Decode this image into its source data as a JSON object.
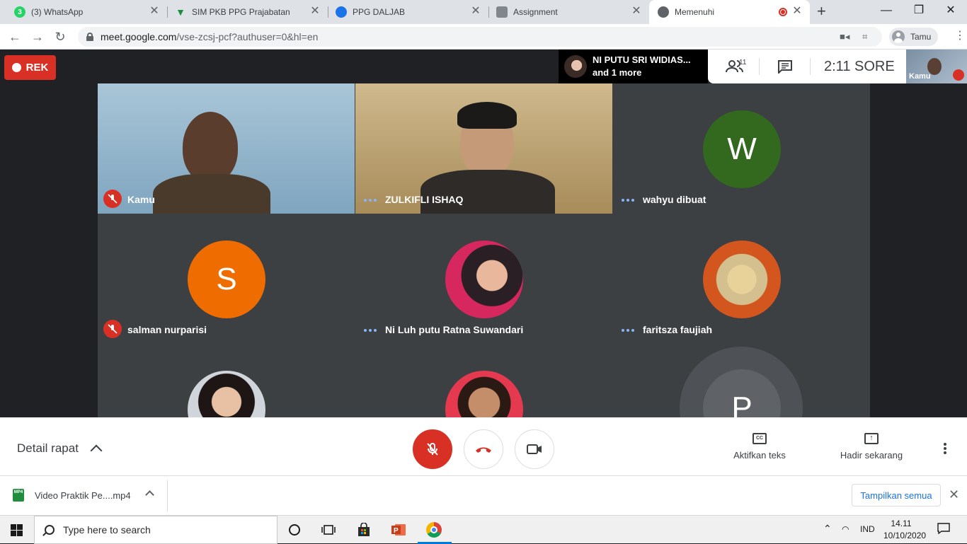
{
  "browser": {
    "tabs": [
      {
        "title": "(3) WhatsApp",
        "badge": "3"
      },
      {
        "title": "SIM PKB PPG Prajabatan"
      },
      {
        "title": "PPG DALJAB"
      },
      {
        "title": "Assignment"
      },
      {
        "title": "Memenuhi"
      }
    ],
    "url_host": "meet.google.com",
    "url_path": "/vse-zcsj-pcf?authuser=0&hl=en",
    "profile_name": "Tamu"
  },
  "meet": {
    "rec_label": "REK",
    "speaker_name": "NI PUTU SRI WIDIAS...",
    "speaker_more": "and 1 more",
    "participant_count": "11",
    "time": "2:11  SORE",
    "self_label": "Kamu",
    "tiles": [
      {
        "name": "Kamu",
        "muted": true
      },
      {
        "name": "ZULKIFLI ISHAQ",
        "muted": false
      },
      {
        "name": "wahyu dibuat",
        "muted": false,
        "initial": "W",
        "color": "#33691e"
      },
      {
        "name": "salman nurparisi",
        "muted": true,
        "initial": "S",
        "color": "#ef6c00"
      },
      {
        "name": "Ni Luh putu Ratna Suwandari",
        "muted": false
      },
      {
        "name": "faritsza faujiah",
        "muted": false
      },
      {
        "name": "",
        "muted": false
      },
      {
        "name": "",
        "muted": false
      },
      {
        "name": "",
        "muted": false,
        "initial": "P",
        "color": "#5f6368"
      }
    ],
    "meeting_details": "Detail rapat",
    "captions_label": "Aktifkan teks",
    "captions_icon": "CC",
    "present_label": "Hadir sekarang"
  },
  "downloads": {
    "file": "Video Praktik Pe....mp4",
    "file_badge": "MP4",
    "show_all": "Tampilkan semua"
  },
  "taskbar": {
    "search_placeholder": "Type here to search",
    "lang": "IND",
    "time": "14.11",
    "date": "10/10/2020"
  }
}
